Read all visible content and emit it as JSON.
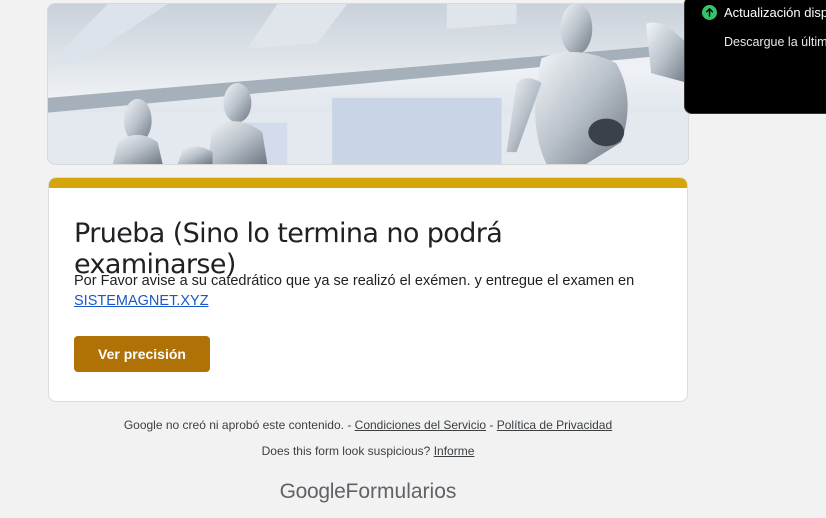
{
  "form": {
    "title": "Prueba (Sino lo termina no podrá examinarse)",
    "description": "Por Favor avise a su catedrático que ya se realizó el exémen. y entregue el examen en",
    "link_text": "SISTEMAGNET.XYZ",
    "button_label": "Ver precisión",
    "accent_color": "#d5a60a",
    "button_color": "#b07106"
  },
  "footer": {
    "disclaimer": "Google no creó ni aprobó este contenido. -",
    "terms_link": "Condiciones del Servicio",
    "separator": "-",
    "privacy_link": "Política de Privacidad",
    "suspicious_text": "Does this form look suspicious?",
    "report_link": "Informe",
    "logo_google": "Google",
    "logo_product": "Formularios"
  },
  "toast": {
    "icon": "arrow-up-circle-icon",
    "title": "Actualización dispo",
    "body": "Descargue la última"
  }
}
